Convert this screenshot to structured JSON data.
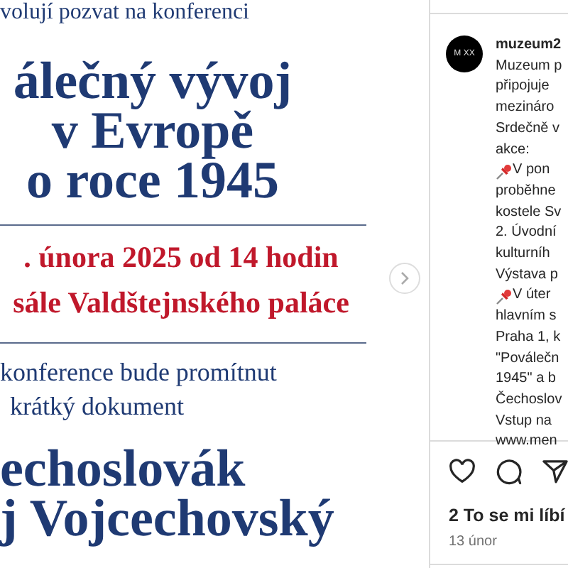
{
  "poster": {
    "intro": "volují pozvat na konferenci",
    "title_lines": [
      "álečný vývoj",
      "v Evropě",
      "o roce 1945"
    ],
    "date_lines": [
      ". února 2025 od 14 hodin",
      "sále Valdštejnského paláce"
    ],
    "note_lines": [
      "konference bude promítnut",
      "krátký dokument"
    ],
    "name_lines": [
      "echoslovák",
      "j Vojcechovský"
    ]
  },
  "post": {
    "avatar_text": "M XX",
    "username": "muzeum2",
    "caption_lines": [
      {
        "kind": "text",
        "text": "Muzeum p"
      },
      {
        "kind": "text",
        "text": "připojuje"
      },
      {
        "kind": "text",
        "text": "mezináro"
      },
      {
        "kind": "text",
        "text": "Srdečně v"
      },
      {
        "kind": "text",
        "text": "akce:"
      },
      {
        "kind": "pin",
        "text": "V pon"
      },
      {
        "kind": "text",
        "text": "proběhne"
      },
      {
        "kind": "text",
        "text": "kostele Sv"
      },
      {
        "kind": "text",
        "text": "2. Úvodní"
      },
      {
        "kind": "text",
        "text": "kulturníh"
      },
      {
        "kind": "text",
        "text": "Výstava p"
      },
      {
        "kind": "pin",
        "text": "V úter"
      },
      {
        "kind": "text",
        "text": "hlavním s"
      },
      {
        "kind": "text",
        "text": "Praha 1, k"
      },
      {
        "kind": "text",
        "text": "\"Poválečn"
      },
      {
        "kind": "text",
        "text": "1945\" a b"
      },
      {
        "kind": "text",
        "text": "Čechoslov"
      },
      {
        "kind": "text",
        "text": "Vstup na"
      },
      {
        "kind": "text",
        "text": "www.men"
      }
    ],
    "likes": "2 To se mi líbí",
    "date": "13 únor"
  }
}
